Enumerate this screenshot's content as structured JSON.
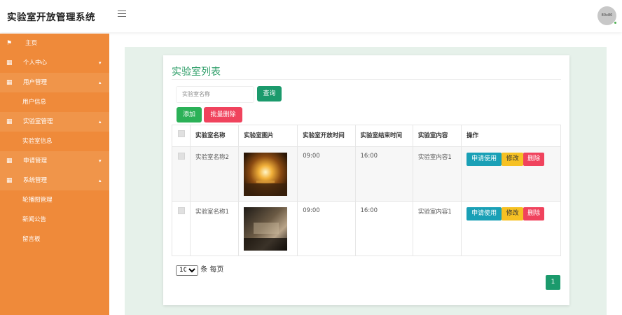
{
  "app": {
    "title": "实验室开放管理系统"
  },
  "avatar": {
    "text": "80x80"
  },
  "sidebar": {
    "items": [
      {
        "label": "主页",
        "icon": "flag-icon"
      },
      {
        "label": "个人中心",
        "icon": "grid-icon",
        "arrow": "▾"
      },
      {
        "label": "用户管理",
        "icon": "grid-icon",
        "arrow": "▴"
      },
      {
        "label": "用户信息"
      },
      {
        "label": "实验室管理",
        "icon": "grid-icon",
        "arrow": "▴"
      },
      {
        "label": "实验室信息"
      },
      {
        "label": "申请管理",
        "icon": "grid-icon",
        "arrow": "▾"
      },
      {
        "label": "系统管理",
        "icon": "grid-icon",
        "arrow": "▴"
      },
      {
        "label": "轮播图管理"
      },
      {
        "label": "新闻公告"
      },
      {
        "label": "留言板"
      }
    ]
  },
  "main": {
    "title": "实验室列表",
    "search_placeholder": "实验室名称",
    "query_label": "查询",
    "add_label": "添加",
    "batch_delete_label": "批量删除",
    "columns": [
      "实验室名称",
      "实验室图片",
      "实验室开放时间",
      "实验室结束时间",
      "实验室内容",
      "操作"
    ],
    "rows": [
      {
        "name": "实验室名称2",
        "open": "09:00",
        "close": "16:00",
        "content": "实验室内容1"
      },
      {
        "name": "实验室名称1",
        "open": "09:00",
        "close": "16:00",
        "content": "实验室内容1"
      }
    ],
    "actions": {
      "apply": "申请使用",
      "edit": "修改",
      "delete": "删除"
    },
    "page_size": "10",
    "page_size_suffix": "条 每页",
    "current_page": "1"
  }
}
